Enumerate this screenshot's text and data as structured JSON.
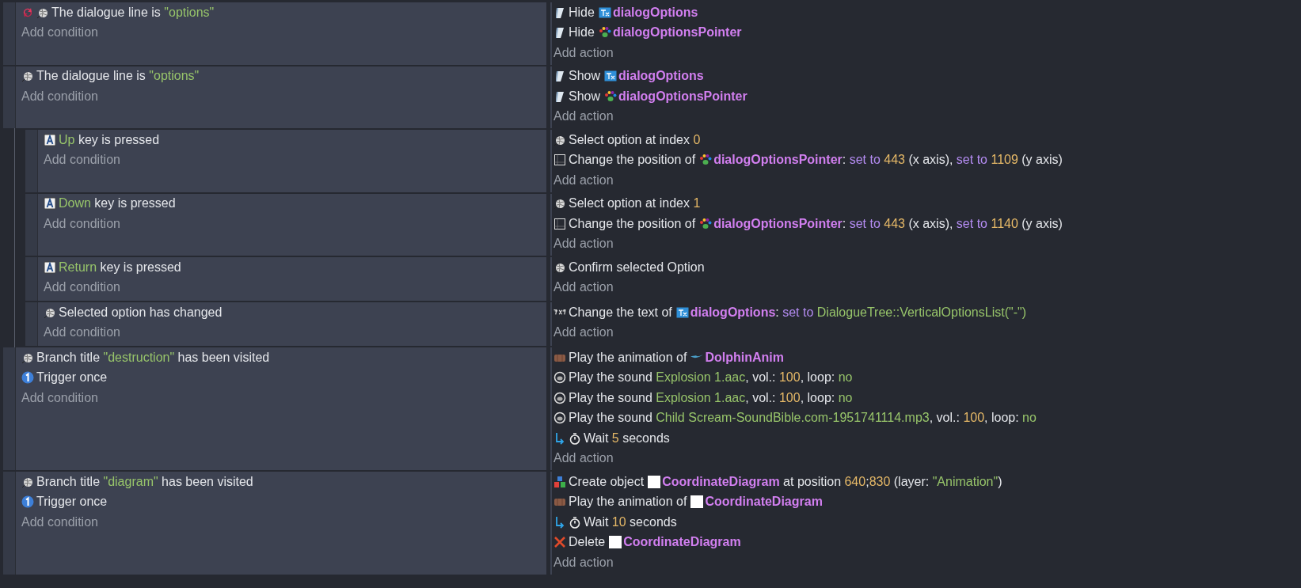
{
  "events": [
    {
      "conditions": [
        {
          "icons": [
            {
              "kind": "loop"
            },
            {
              "kind": "dialogue"
            }
          ],
          "parts": [
            {
              "kind": "words",
              "runs": [
                {
                  "kind": "plain",
                  "text": "The dialogue line is "
                },
                {
                  "kind": "string",
                  "text": "\"options\""
                }
              ]
            }
          ]
        }
      ],
      "add_condition": "Add condition",
      "actions": [
        {
          "icons": [
            {
              "kind": "visibility"
            }
          ],
          "parts": [
            {
              "kind": "words",
              "runs": [
                {
                  "kind": "plain",
                  "text": "Hide"
                }
              ]
            },
            {
              "kind": "text-object"
            },
            {
              "kind": "words",
              "runs": [
                {
                  "kind": "object",
                  "text": "dialogOptions"
                }
              ]
            }
          ]
        },
        {
          "icons": [
            {
              "kind": "visibility"
            }
          ],
          "parts": [
            {
              "kind": "words",
              "runs": [
                {
                  "kind": "plain",
                  "text": "Hide"
                }
              ]
            },
            {
              "kind": "sprite-object"
            },
            {
              "kind": "words",
              "runs": [
                {
                  "kind": "object",
                  "text": "dialogOptionsPointer"
                }
              ]
            }
          ]
        }
      ],
      "add_action": "Add action"
    },
    {
      "conditions": [
        {
          "icons": [
            {
              "kind": "dialogue"
            }
          ],
          "parts": [
            {
              "kind": "words",
              "runs": [
                {
                  "kind": "plain",
                  "text": "The dialogue line is "
                },
                {
                  "kind": "string",
                  "text": "\"options\""
                }
              ]
            }
          ]
        }
      ],
      "add_condition": "Add condition",
      "actions": [
        {
          "icons": [
            {
              "kind": "visibility"
            }
          ],
          "parts": [
            {
              "kind": "words",
              "runs": [
                {
                  "kind": "plain",
                  "text": "Show"
                }
              ]
            },
            {
              "kind": "text-object"
            },
            {
              "kind": "words",
              "runs": [
                {
                  "kind": "object",
                  "text": "dialogOptions"
                }
              ]
            }
          ]
        },
        {
          "icons": [
            {
              "kind": "visibility"
            }
          ],
          "parts": [
            {
              "kind": "words",
              "runs": [
                {
                  "kind": "plain",
                  "text": "Show"
                }
              ]
            },
            {
              "kind": "sprite-object"
            },
            {
              "kind": "words",
              "runs": [
                {
                  "kind": "object",
                  "text": "dialogOptionsPointer"
                }
              ]
            }
          ]
        }
      ],
      "add_action": "Add action",
      "children": [
        {
          "conditions": [
            {
              "icons": [
                {
                  "kind": "key"
                }
              ],
              "parts": [
                {
                  "kind": "words",
                  "runs": [
                    {
                      "kind": "string",
                      "text": "Up"
                    },
                    {
                      "kind": "plain",
                      "text": " key is pressed"
                    }
                  ]
                }
              ]
            }
          ],
          "add_condition": "Add condition",
          "actions": [
            {
              "icons": [
                {
                  "kind": "dialogue"
                }
              ],
              "parts": [
                {
                  "kind": "words",
                  "runs": [
                    {
                      "kind": "plain",
                      "text": "Select option at index "
                    },
                    {
                      "kind": "number",
                      "text": "0"
                    }
                  ]
                }
              ]
            },
            {
              "icons": [
                {
                  "kind": "position"
                }
              ],
              "parts": [
                {
                  "kind": "words",
                  "runs": [
                    {
                      "kind": "plain",
                      "text": "Change the position of"
                    }
                  ]
                },
                {
                  "kind": "sprite-object"
                },
                {
                  "kind": "words",
                  "runs": [
                    {
                      "kind": "object",
                      "text": "dialogOptionsPointer"
                    },
                    {
                      "kind": "plain",
                      "text": ": "
                    },
                    {
                      "kind": "param",
                      "text": "set to "
                    },
                    {
                      "kind": "number",
                      "text": "443"
                    },
                    {
                      "kind": "plain",
                      "text": " (x axis), "
                    },
                    {
                      "kind": "param",
                      "text": "set to "
                    },
                    {
                      "kind": "number",
                      "text": "1109"
                    },
                    {
                      "kind": "plain",
                      "text": " (y axis)"
                    }
                  ]
                }
              ]
            }
          ],
          "add_action": "Add action"
        },
        {
          "conditions": [
            {
              "icons": [
                {
                  "kind": "key"
                }
              ],
              "parts": [
                {
                  "kind": "words",
                  "runs": [
                    {
                      "kind": "string",
                      "text": "Down"
                    },
                    {
                      "kind": "plain",
                      "text": " key is pressed"
                    }
                  ]
                }
              ]
            }
          ],
          "add_condition": "Add condition",
          "actions": [
            {
              "icons": [
                {
                  "kind": "dialogue"
                }
              ],
              "parts": [
                {
                  "kind": "words",
                  "runs": [
                    {
                      "kind": "plain",
                      "text": "Select option at index "
                    },
                    {
                      "kind": "number",
                      "text": "1"
                    }
                  ]
                }
              ]
            },
            {
              "icons": [
                {
                  "kind": "position"
                }
              ],
              "parts": [
                {
                  "kind": "words",
                  "runs": [
                    {
                      "kind": "plain",
                      "text": "Change the position of"
                    }
                  ]
                },
                {
                  "kind": "sprite-object"
                },
                {
                  "kind": "words",
                  "runs": [
                    {
                      "kind": "object",
                      "text": "dialogOptionsPointer"
                    },
                    {
                      "kind": "plain",
                      "text": ": "
                    },
                    {
                      "kind": "param",
                      "text": "set to "
                    },
                    {
                      "kind": "number",
                      "text": "443"
                    },
                    {
                      "kind": "plain",
                      "text": " (x axis), "
                    },
                    {
                      "kind": "param",
                      "text": "set to "
                    },
                    {
                      "kind": "number",
                      "text": "1140"
                    },
                    {
                      "kind": "plain",
                      "text": " (y axis)"
                    }
                  ]
                }
              ]
            }
          ],
          "add_action": "Add action"
        },
        {
          "conditions": [
            {
              "icons": [
                {
                  "kind": "key"
                }
              ],
              "parts": [
                {
                  "kind": "words",
                  "runs": [
                    {
                      "kind": "string",
                      "text": "Return"
                    },
                    {
                      "kind": "plain",
                      "text": " key is pressed"
                    }
                  ]
                }
              ]
            }
          ],
          "add_condition": "Add condition",
          "actions": [
            {
              "icons": [
                {
                  "kind": "dialogue"
                }
              ],
              "parts": [
                {
                  "kind": "words",
                  "runs": [
                    {
                      "kind": "plain",
                      "text": "Confirm selected Option"
                    }
                  ]
                }
              ]
            }
          ],
          "add_action": "Add action"
        },
        {
          "conditions": [
            {
              "icons": [
                {
                  "kind": "dialogue"
                }
              ],
              "parts": [
                {
                  "kind": "words",
                  "runs": [
                    {
                      "kind": "plain",
                      "text": "Selected option has changed"
                    }
                  ]
                }
              ]
            }
          ],
          "add_condition": "Add condition",
          "actions": [
            {
              "icons": [
                {
                  "kind": "text"
                }
              ],
              "parts": [
                {
                  "kind": "words",
                  "runs": [
                    {
                      "kind": "plain",
                      "text": "Change the text of"
                    }
                  ]
                },
                {
                  "kind": "text-object"
                },
                {
                  "kind": "words",
                  "runs": [
                    {
                      "kind": "object",
                      "text": "dialogOptions"
                    },
                    {
                      "kind": "plain",
                      "text": ": "
                    },
                    {
                      "kind": "param",
                      "text": "set to "
                    },
                    {
                      "kind": "string",
                      "text": "DialogueTree::VerticalOptionsList(\"-\")"
                    }
                  ]
                }
              ]
            }
          ],
          "add_action": "Add action"
        }
      ]
    },
    {
      "conditions": [
        {
          "icons": [
            {
              "kind": "dialogue"
            }
          ],
          "parts": [
            {
              "kind": "words",
              "runs": [
                {
                  "kind": "plain",
                  "text": "Branch title "
                },
                {
                  "kind": "string",
                  "text": "\"destruction\""
                },
                {
                  "kind": "plain",
                  "text": " has been visited"
                }
              ]
            }
          ]
        },
        {
          "icons": [
            {
              "kind": "once"
            }
          ],
          "parts": [
            {
              "kind": "words",
              "runs": [
                {
                  "kind": "plain",
                  "text": "Trigger once"
                }
              ]
            }
          ]
        }
      ],
      "add_condition": "Add condition",
      "actions": [
        {
          "icons": [
            {
              "kind": "animation"
            }
          ],
          "parts": [
            {
              "kind": "words",
              "runs": [
                {
                  "kind": "plain",
                  "text": "Play the animation of"
                }
              ]
            },
            {
              "kind": "dolphin-object"
            },
            {
              "kind": "words",
              "runs": [
                {
                  "kind": "object",
                  "text": "DolphinAnim"
                }
              ]
            }
          ]
        },
        {
          "icons": [
            {
              "kind": "sound"
            }
          ],
          "parts": [
            {
              "kind": "words",
              "runs": [
                {
                  "kind": "plain",
                  "text": "Play the sound "
                },
                {
                  "kind": "string",
                  "text": "Explosion 1.aac"
                },
                {
                  "kind": "plain",
                  "text": ", vol.: "
                },
                {
                  "kind": "number",
                  "text": "100"
                },
                {
                  "kind": "plain",
                  "text": ", loop: "
                },
                {
                  "kind": "string",
                  "text": "no"
                }
              ]
            }
          ]
        },
        {
          "icons": [
            {
              "kind": "sound"
            }
          ],
          "parts": [
            {
              "kind": "words",
              "runs": [
                {
                  "kind": "plain",
                  "text": "Play the sound "
                },
                {
                  "kind": "string",
                  "text": "Explosion 1.aac"
                },
                {
                  "kind": "plain",
                  "text": ", vol.: "
                },
                {
                  "kind": "number",
                  "text": "100"
                },
                {
                  "kind": "plain",
                  "text": ", loop: "
                },
                {
                  "kind": "string",
                  "text": "no"
                }
              ]
            }
          ]
        },
        {
          "icons": [
            {
              "kind": "sound"
            }
          ],
          "parts": [
            {
              "kind": "words",
              "runs": [
                {
                  "kind": "plain",
                  "text": "Play the sound "
                },
                {
                  "kind": "string",
                  "text": "Child Scream-SoundBible.com-1951741114.mp3"
                },
                {
                  "kind": "plain",
                  "text": ", vol.: "
                },
                {
                  "kind": "number",
                  "text": "100"
                },
                {
                  "kind": "plain",
                  "text": ", loop: "
                },
                {
                  "kind": "string",
                  "text": "no"
                }
              ]
            }
          ]
        },
        {
          "icons": [
            {
              "kind": "async"
            },
            {
              "kind": "timer"
            }
          ],
          "parts": [
            {
              "kind": "words",
              "runs": [
                {
                  "kind": "plain",
                  "text": "Wait "
                },
                {
                  "kind": "number",
                  "text": "5"
                },
                {
                  "kind": "plain",
                  "text": " seconds"
                }
              ]
            }
          ]
        }
      ],
      "add_action": "Add action"
    },
    {
      "conditions": [
        {
          "icons": [
            {
              "kind": "dialogue"
            }
          ],
          "parts": [
            {
              "kind": "words",
              "runs": [
                {
                  "kind": "plain",
                  "text": "Branch title "
                },
                {
                  "kind": "string",
                  "text": "\"diagram\""
                },
                {
                  "kind": "plain",
                  "text": " has been visited"
                }
              ]
            }
          ]
        },
        {
          "icons": [
            {
              "kind": "once"
            }
          ],
          "parts": [
            {
              "kind": "words",
              "runs": [
                {
                  "kind": "plain",
                  "text": "Trigger once"
                }
              ]
            }
          ]
        }
      ],
      "add_condition": "Add condition",
      "actions": [
        {
          "icons": [
            {
              "kind": "create"
            }
          ],
          "parts": [
            {
              "kind": "words",
              "runs": [
                {
                  "kind": "plain",
                  "text": "Create object"
                }
              ]
            },
            {
              "kind": "blank-object"
            },
            {
              "kind": "words",
              "runs": [
                {
                  "kind": "object",
                  "text": "CoordinateDiagram"
                },
                {
                  "kind": "plain",
                  "text": " at position "
                },
                {
                  "kind": "number",
                  "text": "640"
                },
                {
                  "kind": "plain",
                  "text": ";"
                },
                {
                  "kind": "number",
                  "text": "830"
                },
                {
                  "kind": "plain",
                  "text": " (layer: "
                },
                {
                  "kind": "string",
                  "text": "\"Animation\""
                },
                {
                  "kind": "plain",
                  "text": ")"
                }
              ]
            }
          ]
        },
        {
          "icons": [
            {
              "kind": "animation"
            }
          ],
          "parts": [
            {
              "kind": "words",
              "runs": [
                {
                  "kind": "plain",
                  "text": "Play the animation of"
                }
              ]
            },
            {
              "kind": "blank-object"
            },
            {
              "kind": "words",
              "runs": [
                {
                  "kind": "object",
                  "text": "CoordinateDiagram"
                }
              ]
            }
          ]
        },
        {
          "icons": [
            {
              "kind": "async"
            },
            {
              "kind": "timer"
            }
          ],
          "parts": [
            {
              "kind": "words",
              "runs": [
                {
                  "kind": "plain",
                  "text": "Wait "
                },
                {
                  "kind": "number",
                  "text": "10"
                },
                {
                  "kind": "plain",
                  "text": " seconds"
                }
              ]
            }
          ]
        },
        {
          "icons": [
            {
              "kind": "delete"
            }
          ],
          "parts": [
            {
              "kind": "words",
              "runs": [
                {
                  "kind": "plain",
                  "text": "Delete"
                }
              ]
            },
            {
              "kind": "blank-object"
            },
            {
              "kind": "words",
              "runs": [
                {
                  "kind": "object",
                  "text": "CoordinateDiagram"
                }
              ]
            }
          ]
        }
      ],
      "add_action": "Add action"
    }
  ]
}
